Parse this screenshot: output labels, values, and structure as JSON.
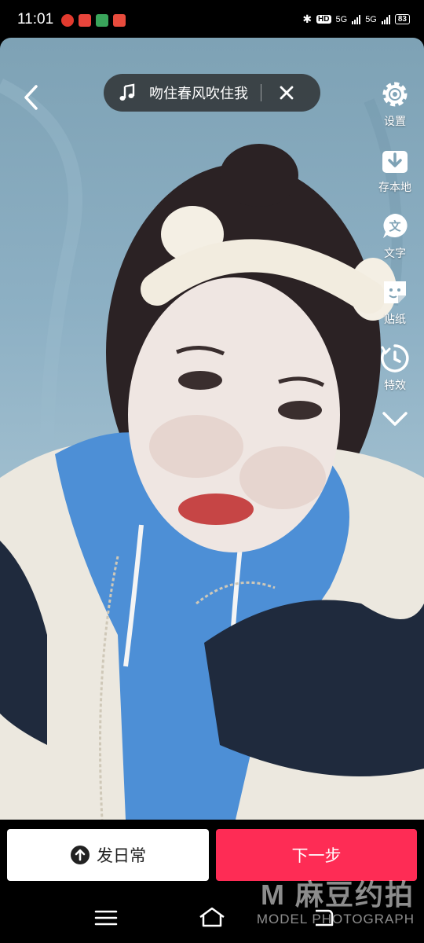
{
  "status_bar": {
    "time": "11:01",
    "hd_label": "HD",
    "network_1": "5G",
    "network_2": "5G",
    "battery": "83"
  },
  "top_bar": {
    "music_title": "吻住春风吹住我",
    "back_icon": "chevron-left-icon",
    "close_icon": "close-icon"
  },
  "tools": [
    {
      "label": "设置",
      "icon": "gear-icon"
    },
    {
      "label": "存本地",
      "icon": "download-icon"
    },
    {
      "label": "文字",
      "icon": "text-icon"
    },
    {
      "label": "贴纸",
      "icon": "sticker-icon"
    },
    {
      "label": "特效",
      "icon": "effects-icon"
    }
  ],
  "bottom": {
    "daily_label": "发日常",
    "next_label": "下一步"
  },
  "watermark": {
    "main": "M 麻豆约拍",
    "sub": "MODEL PHOTOGRAPH"
  },
  "colors": {
    "accent": "#fe2c55",
    "pill_bg": "#282828"
  }
}
